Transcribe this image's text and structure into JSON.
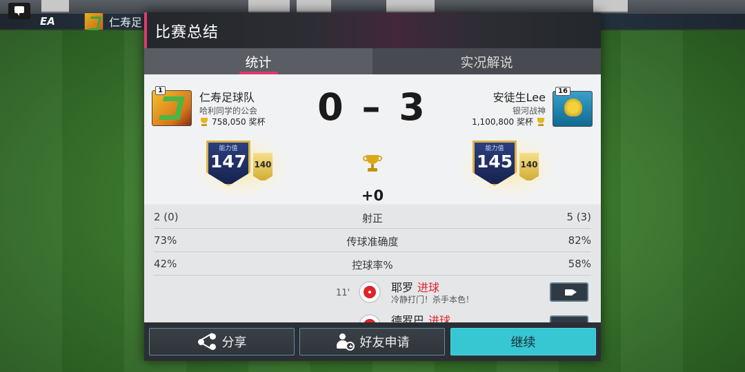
{
  "top_bar": {
    "team_name": "仁寿足",
    "ea_logo_text": "EA"
  },
  "dialog": {
    "title": "比赛总结",
    "tabs": [
      {
        "label": "统计",
        "active": true
      },
      {
        "label": "实况解说",
        "active": false
      }
    ]
  },
  "home": {
    "level": "1",
    "name": "仁寿足球队",
    "league": "哈利同学的公会",
    "trophies": "758,050 奖杯",
    "rating_label": "能力值",
    "rating": "147",
    "card_value": "140"
  },
  "away": {
    "level": "16",
    "name": "安徒生Lee",
    "league": "银河战神",
    "trophies": "1,100,800 奖杯",
    "rating_label": "能力值",
    "rating": "145",
    "card_value": "140"
  },
  "score": "0 – 3",
  "trophy_delta": "+0",
  "stats": [
    {
      "home": "2 (0)",
      "label": "射正",
      "away": "5 (3)"
    },
    {
      "home": "73%",
      "label": "传球准确度",
      "away": "82%"
    },
    {
      "home": "42%",
      "label": "控球率%",
      "away": "58%"
    }
  ],
  "events": [
    {
      "minute": "11'",
      "player": "耶罗",
      "type": "进球",
      "comment": "冷静打门！杀手本色！"
    },
    {
      "minute": "",
      "player": "德罗巴",
      "type": "进球",
      "comment": ""
    }
  ],
  "footer": {
    "share_label": "分享",
    "friend_label": "好友申请",
    "continue_label": "继续"
  },
  "colors": {
    "accent": "#e03a6f",
    "continue": "#36c7d3",
    "goal": "#e0242a"
  }
}
